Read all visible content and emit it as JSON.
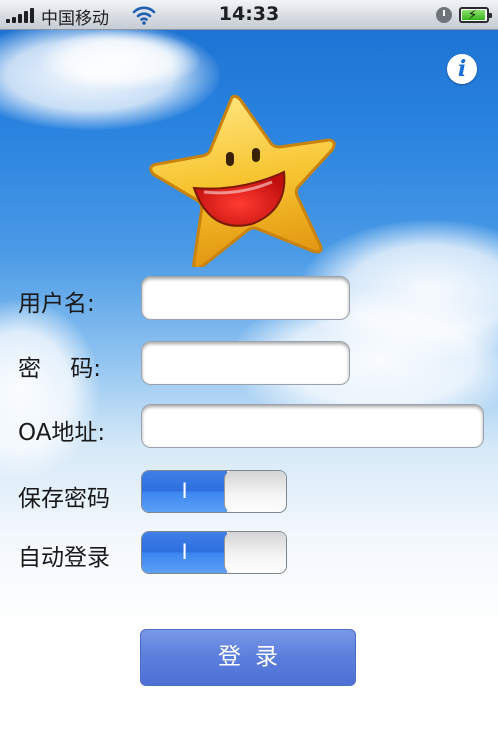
{
  "status_bar": {
    "carrier": "中国移动",
    "time": "14:33"
  },
  "form": {
    "username_label": "用户名:",
    "username_value": "",
    "password_label": "密    码:",
    "password_value": "",
    "oa_address_label": "OA地址:",
    "oa_address_value": "",
    "save_password_label": "保存密码",
    "save_password_toggle_text": "I",
    "auto_login_label": "自动登录",
    "auto_login_toggle_text": "I"
  },
  "login_button_label": "登录",
  "colors": {
    "sky_blue": "#2b84e0",
    "button_blue": "#5b7edd",
    "toggle_on": "#3c86f0"
  },
  "icons": [
    "signal-icon",
    "wifi-icon",
    "lock-rotation-icon",
    "battery-icon",
    "info-icon",
    "star-mascot-icon"
  ]
}
